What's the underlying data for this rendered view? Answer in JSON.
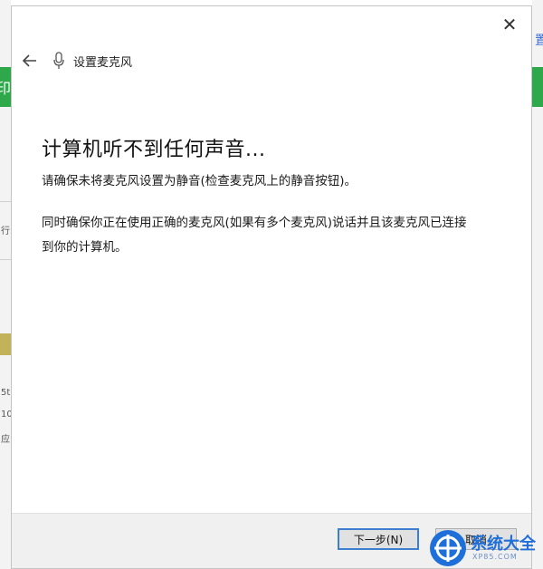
{
  "dialog": {
    "title": "设置麦克风",
    "close_glyph": "✕",
    "heading": "计算机听不到任何声音...",
    "paragraph1": "请确保未将麦克风设置为静音(检查麦克风上的静音按钮)。",
    "paragraph2": "同时确保你正在使用正确的麦克风(如果有多个麦克风)说话并且该麦克风已连接到你的计算机。",
    "next_button": "下一步(N)",
    "cancel_button": "取消"
  },
  "background_window": {
    "fragments": [
      "印",
      "行",
      "5t",
      "10",
      "应"
    ],
    "right_glyph": "置"
  },
  "watermark": {
    "text": "系统大全",
    "sub": "XP85.COM"
  },
  "icons": {
    "back": "arrow-left-icon",
    "mic": "microphone-icon",
    "close": "close-icon"
  },
  "colors": {
    "accent_blue": "#3c7fd0",
    "background_green": "#2ea84a"
  }
}
